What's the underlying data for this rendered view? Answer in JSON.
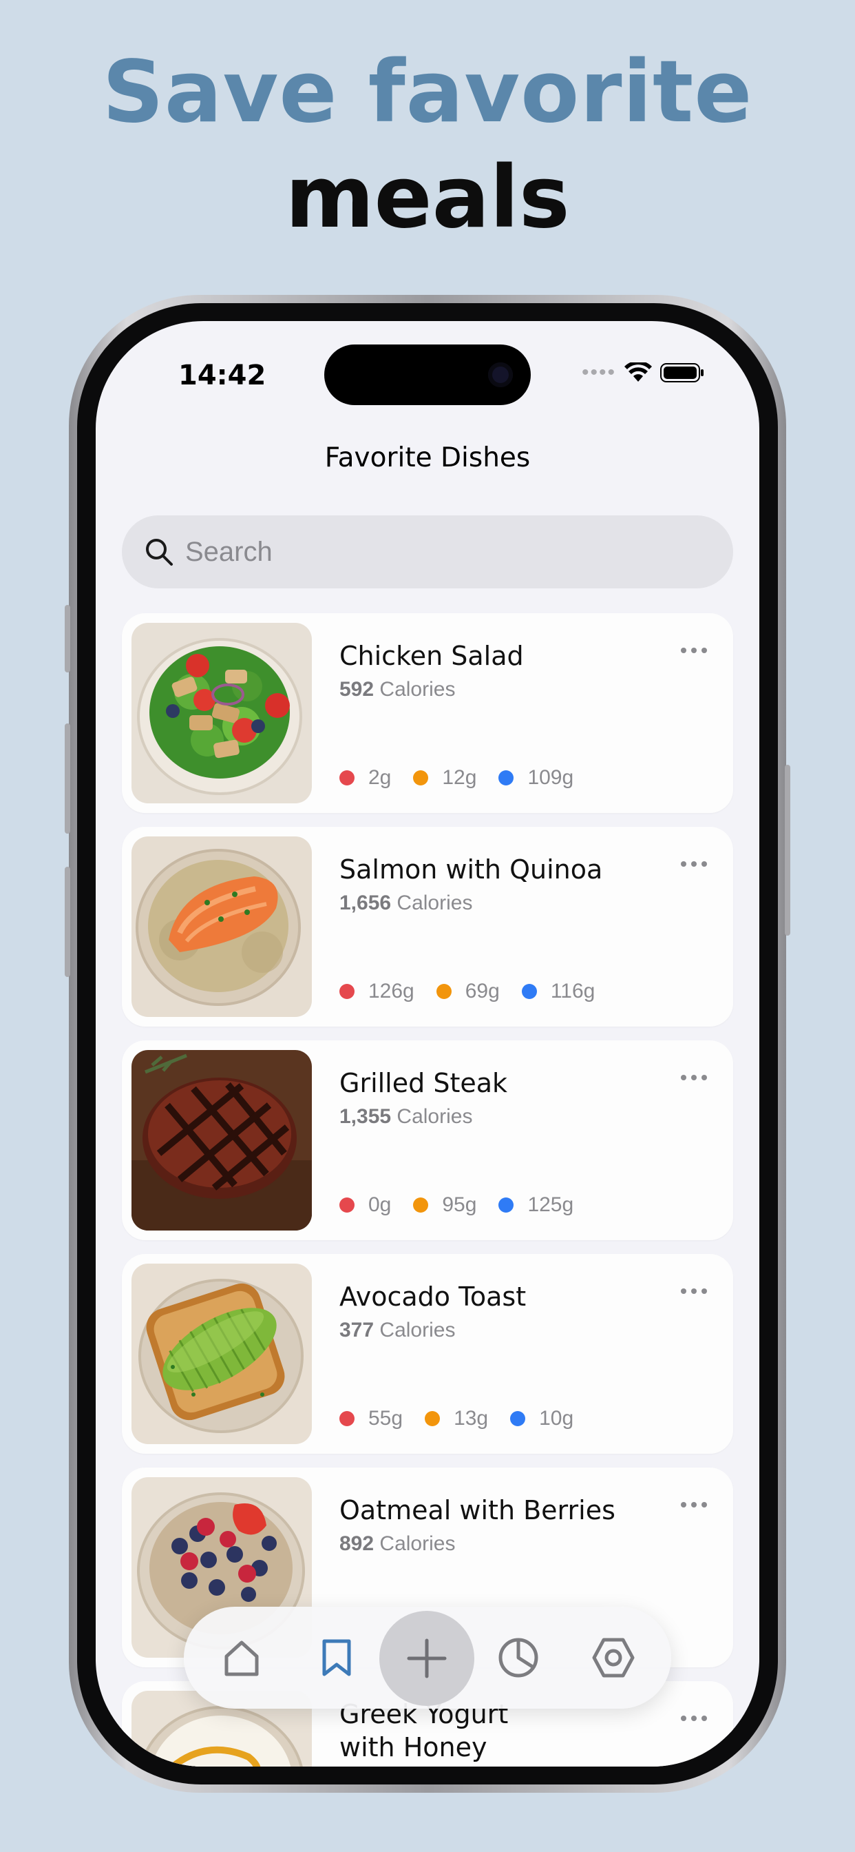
{
  "promo": {
    "line1": "Save favorite",
    "line2": "meals"
  },
  "status_bar": {
    "time": "14:42"
  },
  "nav": {
    "title": "Favorite Dishes"
  },
  "search": {
    "placeholder": "Search"
  },
  "colors": {
    "protein": "#e5484d",
    "carbs": "#f2950c",
    "fat": "#2f7bf5",
    "accent": "#3d7ab8",
    "headline_blue": "#5b87ab"
  },
  "dishes": [
    {
      "name": "Chicken Salad",
      "calories": "592",
      "calories_label": "Calories",
      "protein": "2g",
      "carbs": "12g",
      "fat": "109g"
    },
    {
      "name": "Salmon with Quinoa",
      "calories": "1,656",
      "calories_label": "Calories",
      "protein": "126g",
      "carbs": "69g",
      "fat": "116g"
    },
    {
      "name": "Grilled Steak",
      "calories": "1,355",
      "calories_label": "Calories",
      "protein": "0g",
      "carbs": "95g",
      "fat": "125g"
    },
    {
      "name": "Avocado Toast",
      "calories": "377",
      "calories_label": "Calories",
      "protein": "55g",
      "carbs": "13g",
      "fat": "10g"
    },
    {
      "name": "Oatmeal with Berries",
      "calories": "892",
      "calories_label": "Calories"
    },
    {
      "name_line1": "Greek Yogurt",
      "name_line2": "with Honey"
    }
  ],
  "tab_bar": {
    "tabs": [
      {
        "icon": "home-icon",
        "active": false
      },
      {
        "icon": "bookmark-icon",
        "active": true
      },
      {
        "icon": "plus-icon",
        "active": false
      },
      {
        "icon": "pie-chart-icon",
        "active": false
      },
      {
        "icon": "settings-icon",
        "active": false
      }
    ]
  }
}
